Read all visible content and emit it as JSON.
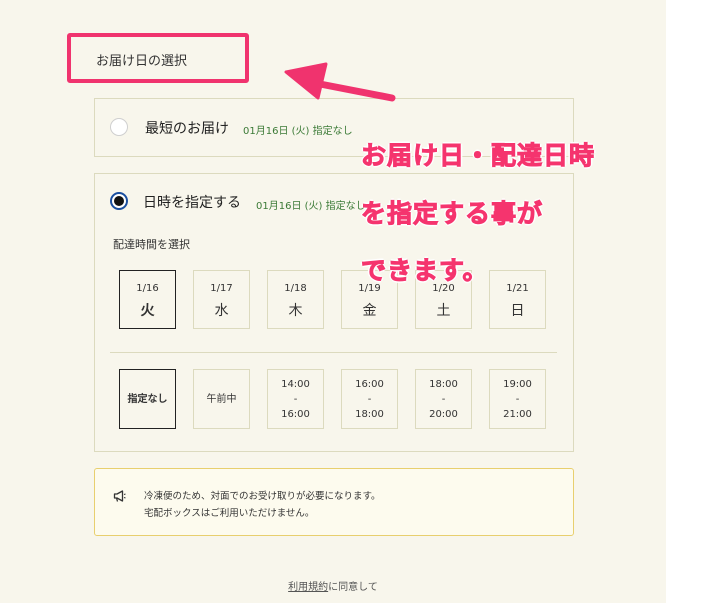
{
  "section": {
    "title": "お届け日の選択"
  },
  "option_earliest": {
    "label": "最短のお届け",
    "date": "01月16日 (火) 指定なし",
    "selected": false
  },
  "option_specify": {
    "label": "日時を指定する",
    "date": "01月16日 (火) 指定なし",
    "selected": true
  },
  "time_label": "配達時間を選択",
  "dates": [
    {
      "date": "1/16",
      "weekday": "火",
      "selected": true
    },
    {
      "date": "1/17",
      "weekday": "水",
      "selected": false
    },
    {
      "date": "1/18",
      "weekday": "木",
      "selected": false
    },
    {
      "date": "1/19",
      "weekday": "金",
      "selected": false
    },
    {
      "date": "1/20",
      "weekday": "土",
      "selected": false
    },
    {
      "date": "1/21",
      "weekday": "日",
      "selected": false
    }
  ],
  "time_slots": [
    {
      "line1": "指定なし",
      "line2": "",
      "line3": "",
      "selected": true
    },
    {
      "line1": "午前中",
      "line2": "",
      "line3": "",
      "selected": false
    },
    {
      "line1": "14:00",
      "line2": "-",
      "line3": "16:00",
      "selected": false
    },
    {
      "line1": "16:00",
      "line2": "-",
      "line3": "18:00",
      "selected": false
    },
    {
      "line1": "18:00",
      "line2": "-",
      "line3": "20:00",
      "selected": false
    },
    {
      "line1": "19:00",
      "line2": "-",
      "line3": "21:00",
      "selected": false
    }
  ],
  "notice": {
    "icon": "megaphone-icon",
    "line1": "冷凍便のため、対面でのお受け取りが必要になります。",
    "line2": "宅配ボックスはご利用いただけません。"
  },
  "footer": {
    "link": "利用規約",
    "text": "に同意して"
  },
  "annotation": {
    "line1": "お届け日・配達日時",
    "line2": "を指定する事が",
    "line3": "できます。"
  },
  "colors": {
    "accent": "#f5346e",
    "panel_bg": "#f8f6ec",
    "border": "#dcdabe",
    "date_green": "#3b7a36"
  }
}
